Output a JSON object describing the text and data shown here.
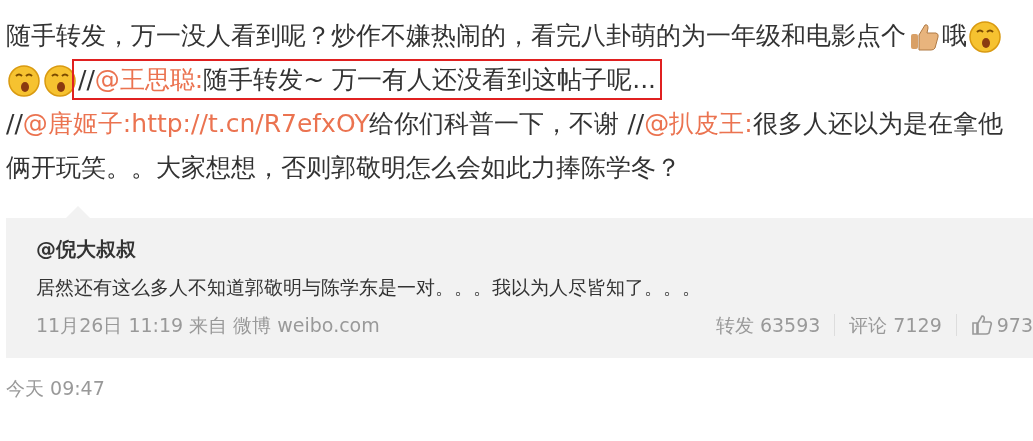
{
  "post": {
    "groups": [
      {
        "highlighted": false,
        "parts": [
          {
            "kind": "text",
            "text": "随手转发，万一没人看到呢？炒作不嫌热闹的，看完八卦萌的为一年级和电影点个"
          },
          {
            "kind": "thumbs-up"
          },
          {
            "kind": "text",
            "text": "哦"
          },
          {
            "kind": "face"
          },
          {
            "kind": "face"
          },
          {
            "kind": "face"
          }
        ]
      },
      {
        "highlighted": true,
        "parts": [
          {
            "kind": "text",
            "text": "//"
          },
          {
            "kind": "mention",
            "text": "@王思聪:"
          },
          {
            "kind": "text",
            "text": "随手转发~ 万一有人还没看到这帖子呢..."
          }
        ]
      },
      {
        "highlighted": false,
        "parts": [
          {
            "kind": "text",
            "text": " //"
          },
          {
            "kind": "mention",
            "text": "@唐姬子:"
          },
          {
            "kind": "mention",
            "text": "http://t.cn/R7efxOY"
          },
          {
            "kind": "text",
            "text": "给你们科普一下，不谢 //"
          },
          {
            "kind": "mention",
            "text": "@扒皮王:"
          },
          {
            "kind": "text",
            "text": "很多人还以为是在拿他俩开玩笑。。大家想想，否则郭敬明怎么会如此力捧陈学冬？"
          }
        ]
      }
    ]
  },
  "quoted": {
    "author": "@倪大叔叔",
    "text": "居然还有这么多人不知道郭敬明与陈学东是一对。。。我以为人尽皆知了。。。",
    "meta": "11月26日 11:19 来自 微博 weibo.com",
    "reposts": "转发 63593",
    "comments": "评论 7129",
    "likes": "973"
  },
  "time": "今天 09:47"
}
